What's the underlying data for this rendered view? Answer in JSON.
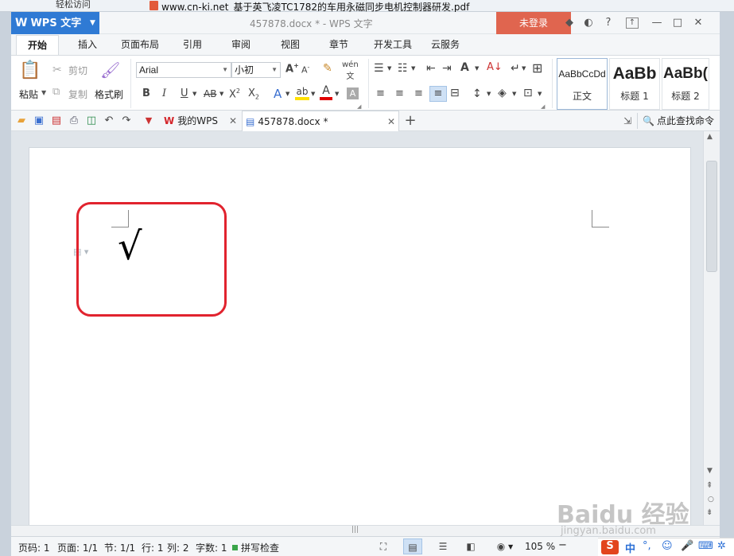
{
  "desktop": {
    "left_item": "轻松访问",
    "file_title": "www.cn-ki.net_基于英飞凌TC1782的车用永磁同步电机控制器研发.pdf"
  },
  "titlebar": {
    "app_name": "WPS 文字",
    "doc_title": "457878.docx * - WPS 文字",
    "login_label": "未登录",
    "icons": [
      "skin-icon",
      "help-icon",
      "restore-icon",
      "minimize-icon",
      "maximize-icon",
      "close-icon"
    ]
  },
  "tabs": [
    "开始",
    "插入",
    "页面布局",
    "引用",
    "审阅",
    "视图",
    "章节",
    "开发工具",
    "云服务"
  ],
  "ribbon": {
    "paste": "粘贴",
    "cut": "剪切",
    "copy": "复制",
    "format_painter": "格式刷",
    "font_name": "Arial",
    "font_size": "小初",
    "styles": [
      {
        "preview": "AaBbCcDd",
        "name": "正文"
      },
      {
        "preview": "AaBb",
        "name": "标题 1"
      },
      {
        "preview": "AaBb(",
        "name": "标题 2"
      }
    ]
  },
  "quickbar": {
    "doc_tabs": [
      {
        "label": "我的WPS",
        "active": false
      },
      {
        "label": "457878.docx *",
        "active": true
      }
    ],
    "search_label": "点此查找命令"
  },
  "document": {
    "content": "√"
  },
  "status": {
    "page_num": "页码: 1",
    "pages": "页面: 1/1",
    "section": "节: 1/1",
    "row": "行: 1",
    "col": "列: 2",
    "word_count": "字数: 1",
    "spell_check": "拼写检查",
    "zoom": "105 %"
  },
  "watermark": {
    "brand": "Baidu 经验",
    "url": "jingyan.baidu.com"
  },
  "ime": {
    "mode": "中"
  },
  "colors": {
    "accent": "#2f7ad4",
    "login_bg": "#e0654f",
    "highlight_border": "#e1232e"
  }
}
